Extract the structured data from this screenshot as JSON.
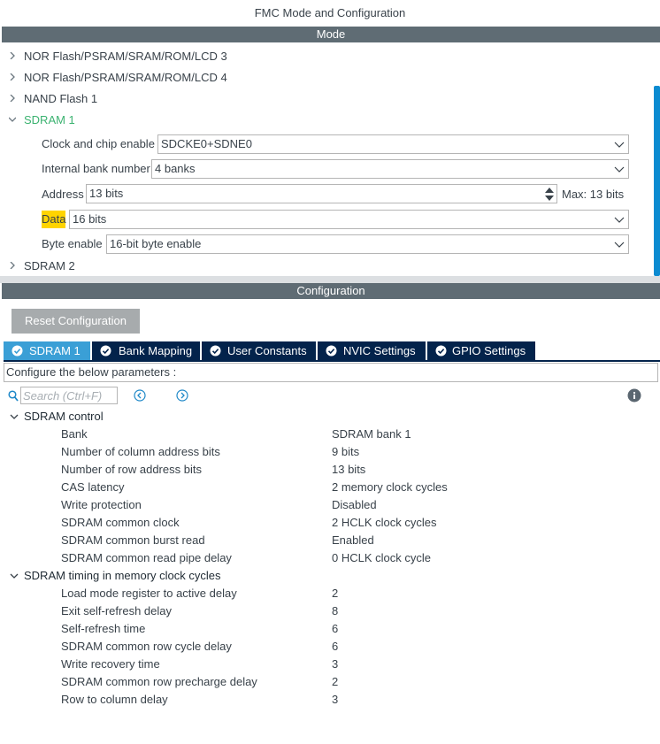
{
  "window": {
    "title": "FMC Mode and Configuration"
  },
  "mode": {
    "header": "Mode",
    "tree": [
      {
        "label": "NOR Flash/PSRAM/SRAM/ROM/LCD 3",
        "expanded": false
      },
      {
        "label": "NOR Flash/PSRAM/SRAM/ROM/LCD 4",
        "expanded": false
      },
      {
        "label": "NAND Flash 1",
        "expanded": false
      },
      {
        "label": "SDRAM 1",
        "expanded": true
      },
      {
        "label": "SDRAM 2",
        "expanded": false
      }
    ],
    "fields": {
      "clock_chip_enable": {
        "label": "Clock and chip enable",
        "value": "SDCKE0+SDNE0"
      },
      "internal_bank": {
        "label": "Internal bank number",
        "value": "4 banks"
      },
      "address": {
        "label": "Address",
        "value": "13 bits",
        "max": "Max: 13 bits"
      },
      "data": {
        "label": "Data",
        "value": "16 bits"
      },
      "byte_enable": {
        "label": "Byte enable",
        "value": "16-bit byte enable"
      }
    }
  },
  "configuration": {
    "header": "Configuration",
    "reset_label": "Reset Configuration",
    "tabs": [
      {
        "label": "SDRAM 1",
        "active": true
      },
      {
        "label": "Bank Mapping",
        "active": false
      },
      {
        "label": "User Constants",
        "active": false
      },
      {
        "label": "NVIC Settings",
        "active": false
      },
      {
        "label": "GPIO Settings",
        "active": false
      }
    ],
    "description": "Configure the below parameters :",
    "search": {
      "placeholder": "Search (Ctrl+F)",
      "value": ""
    },
    "groups": [
      {
        "label": "SDRAM control",
        "params": [
          {
            "name": "Bank",
            "value": "SDRAM bank 1"
          },
          {
            "name": "Number of column address bits",
            "value": "9 bits"
          },
          {
            "name": "Number of row address bits",
            "value": "13 bits"
          },
          {
            "name": "CAS latency",
            "value": "2 memory clock cycles"
          },
          {
            "name": "Write protection",
            "value": "Disabled"
          },
          {
            "name": "SDRAM common clock",
            "value": "2 HCLK clock cycles"
          },
          {
            "name": "SDRAM common burst read",
            "value": "Enabled"
          },
          {
            "name": "SDRAM common read pipe delay",
            "value": "0 HCLK clock cycle"
          }
        ]
      },
      {
        "label": "SDRAM timing in memory clock cycles",
        "params": [
          {
            "name": "Load mode register to active delay",
            "value": "2"
          },
          {
            "name": "Exit self-refresh delay",
            "value": "8"
          },
          {
            "name": "Self-refresh time",
            "value": "6"
          },
          {
            "name": "SDRAM common row cycle delay",
            "value": "6"
          },
          {
            "name": "Write recovery time",
            "value": "3"
          },
          {
            "name": "SDRAM common row precharge delay",
            "value": "2"
          },
          {
            "name": "Row to column delay",
            "value": "3"
          }
        ]
      }
    ]
  },
  "colors": {
    "header_bg": "#5f6c74",
    "active_tree_item": "#3cb371",
    "tab_bg": "#03234b",
    "tab_active_bg": "#3a9fd6",
    "highlight": "#ffd400",
    "scroll_thumb": "#0b8bd1"
  },
  "icons": {
    "tree_expand": "chevron-right-icon",
    "tree_collapse": "chevron-down-icon",
    "tab_status": "check-circle-icon",
    "search": "search-icon",
    "previous": "arrow-left-circle-icon",
    "next": "arrow-right-circle-icon",
    "info": "info-icon"
  }
}
